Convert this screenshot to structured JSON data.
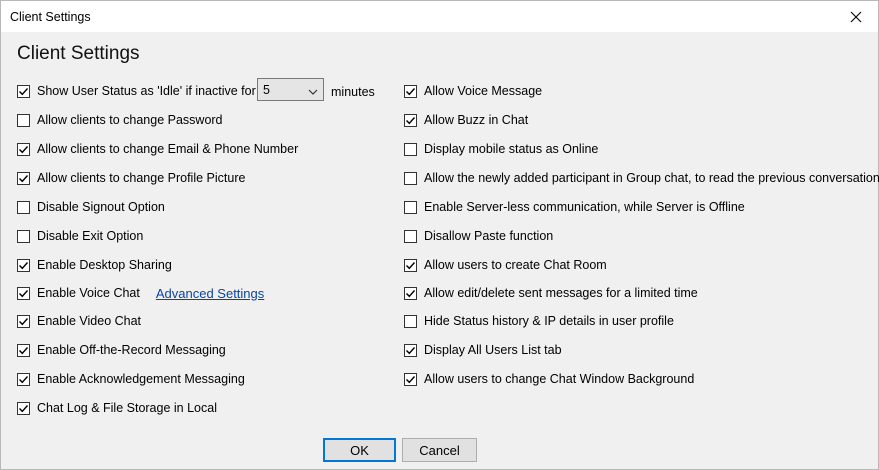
{
  "window": {
    "title": "Client Settings"
  },
  "heading": "Client Settings",
  "idle": {
    "label": "Show User Status as  'Idle' if inactive for",
    "value": "5",
    "unit": "minutes",
    "checked": true
  },
  "left": [
    {
      "label": "Allow clients to change Password",
      "checked": false
    },
    {
      "label": "Allow clients to change Email & Phone Number",
      "checked": true
    },
    {
      "label": "Allow clients to change Profile Picture",
      "checked": true
    },
    {
      "label": "Disable Signout Option",
      "checked": false
    },
    {
      "label": "Disable Exit Option",
      "checked": false
    },
    {
      "label": "Enable Desktop Sharing",
      "checked": true
    },
    {
      "label": "Enable Voice Chat",
      "checked": true,
      "link": "Advanced Settings"
    },
    {
      "label": "Enable Video Chat",
      "checked": true
    },
    {
      "label": "Enable Off-the-Record Messaging",
      "checked": true
    },
    {
      "label": "Enable Acknowledgement Messaging",
      "checked": true
    },
    {
      "label": "Chat Log & File Storage in Local",
      "checked": true
    }
  ],
  "right": [
    {
      "label": "Allow Voice Message",
      "checked": true
    },
    {
      "label": "Allow Buzz in Chat",
      "checked": true
    },
    {
      "label": "Display mobile status as Online",
      "checked": false
    },
    {
      "label": "Allow the newly added participant in Group chat,  to read the previous conversations",
      "checked": false
    },
    {
      "label": "Enable Server-less communication, while Server is Offline",
      "checked": false
    },
    {
      "label": "Disallow Paste function",
      "checked": false
    },
    {
      "label": "Allow users to create Chat Room",
      "checked": true
    },
    {
      "label": "Allow edit/delete sent messages for a limited time",
      "checked": true
    },
    {
      "label": "Hide Status history & IP details in user profile",
      "checked": false
    },
    {
      "label": "Display All Users List tab",
      "checked": true
    },
    {
      "label": "Allow users to change Chat Window Background",
      "checked": true
    }
  ],
  "buttons": {
    "ok": "OK",
    "cancel": "Cancel"
  }
}
